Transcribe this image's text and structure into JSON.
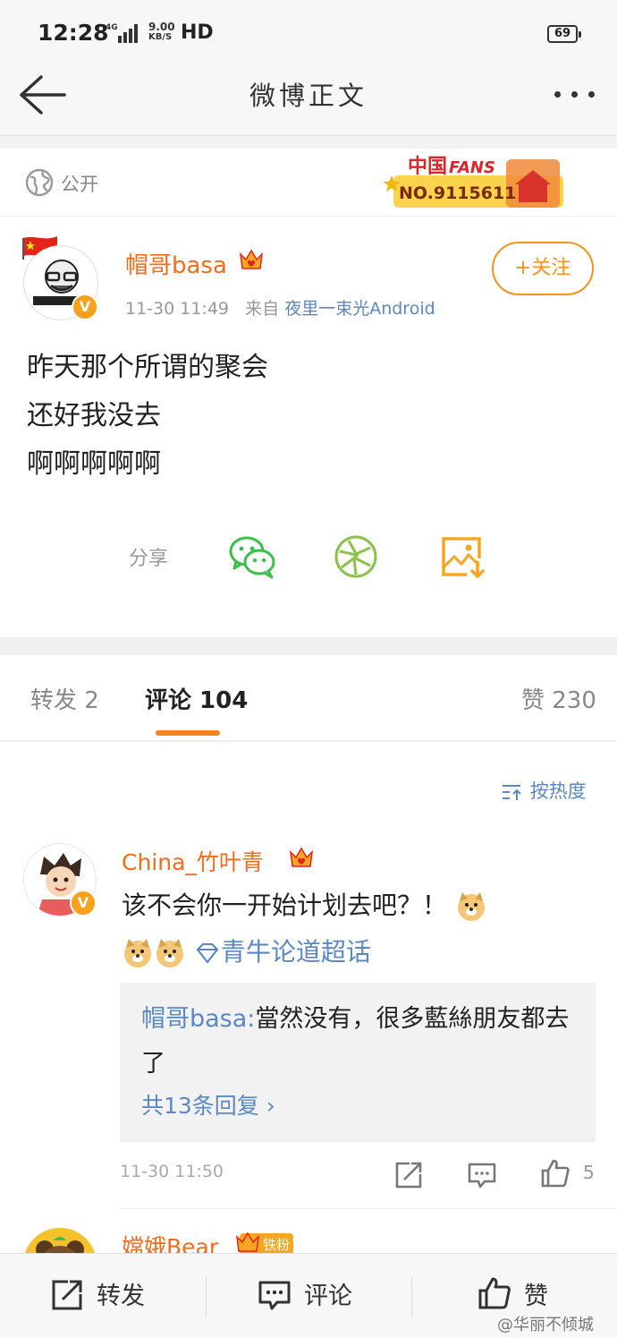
{
  "status_bar": {
    "time": "12:28",
    "network": "4G",
    "speed_value": "9.00",
    "speed_unit": "KB/S",
    "hd": "HD",
    "battery": "69"
  },
  "nav": {
    "title": "微博正文"
  },
  "post": {
    "visibility": "公开",
    "fans_badge": {
      "title": "中国FANS",
      "number": "NO.9115611"
    },
    "user_name": "帽哥basa",
    "time": "11-30 11:49",
    "source_prefix": "来自",
    "source": "夜里一束光Android",
    "follow_label": "+关注",
    "text_lines": [
      "昨天那个所谓的聚会",
      "还好我没去",
      "啊啊啊啊啊"
    ],
    "share_label": "分享"
  },
  "tabs": {
    "repost": "转发 2",
    "comment": "评论 104",
    "like": "赞 230"
  },
  "sort_label": "按热度",
  "comments": [
    {
      "name": "China_竹叶青",
      "text": "该不会你一开始计划去吧？！",
      "topic": "青牛论道超话",
      "reply_user": "帽哥basa:",
      "reply_text": "當然没有，很多藍絲朋友都去了",
      "reply_more": "共13条回复 ›",
      "time": "11-30 11:50",
      "likes": "5"
    },
    {
      "name": "嫦娥Bear",
      "badge": "铁粉"
    }
  ],
  "bottom_bar": {
    "repost": "转发",
    "comment": "评论",
    "like": "赞"
  },
  "watermark": "@华丽不倾城",
  "colors": {
    "accent_orange": "#f36b1c",
    "follow_orange": "#f5931d",
    "link_blue": "#5b88c2",
    "wechat_green": "#3cc04a"
  }
}
